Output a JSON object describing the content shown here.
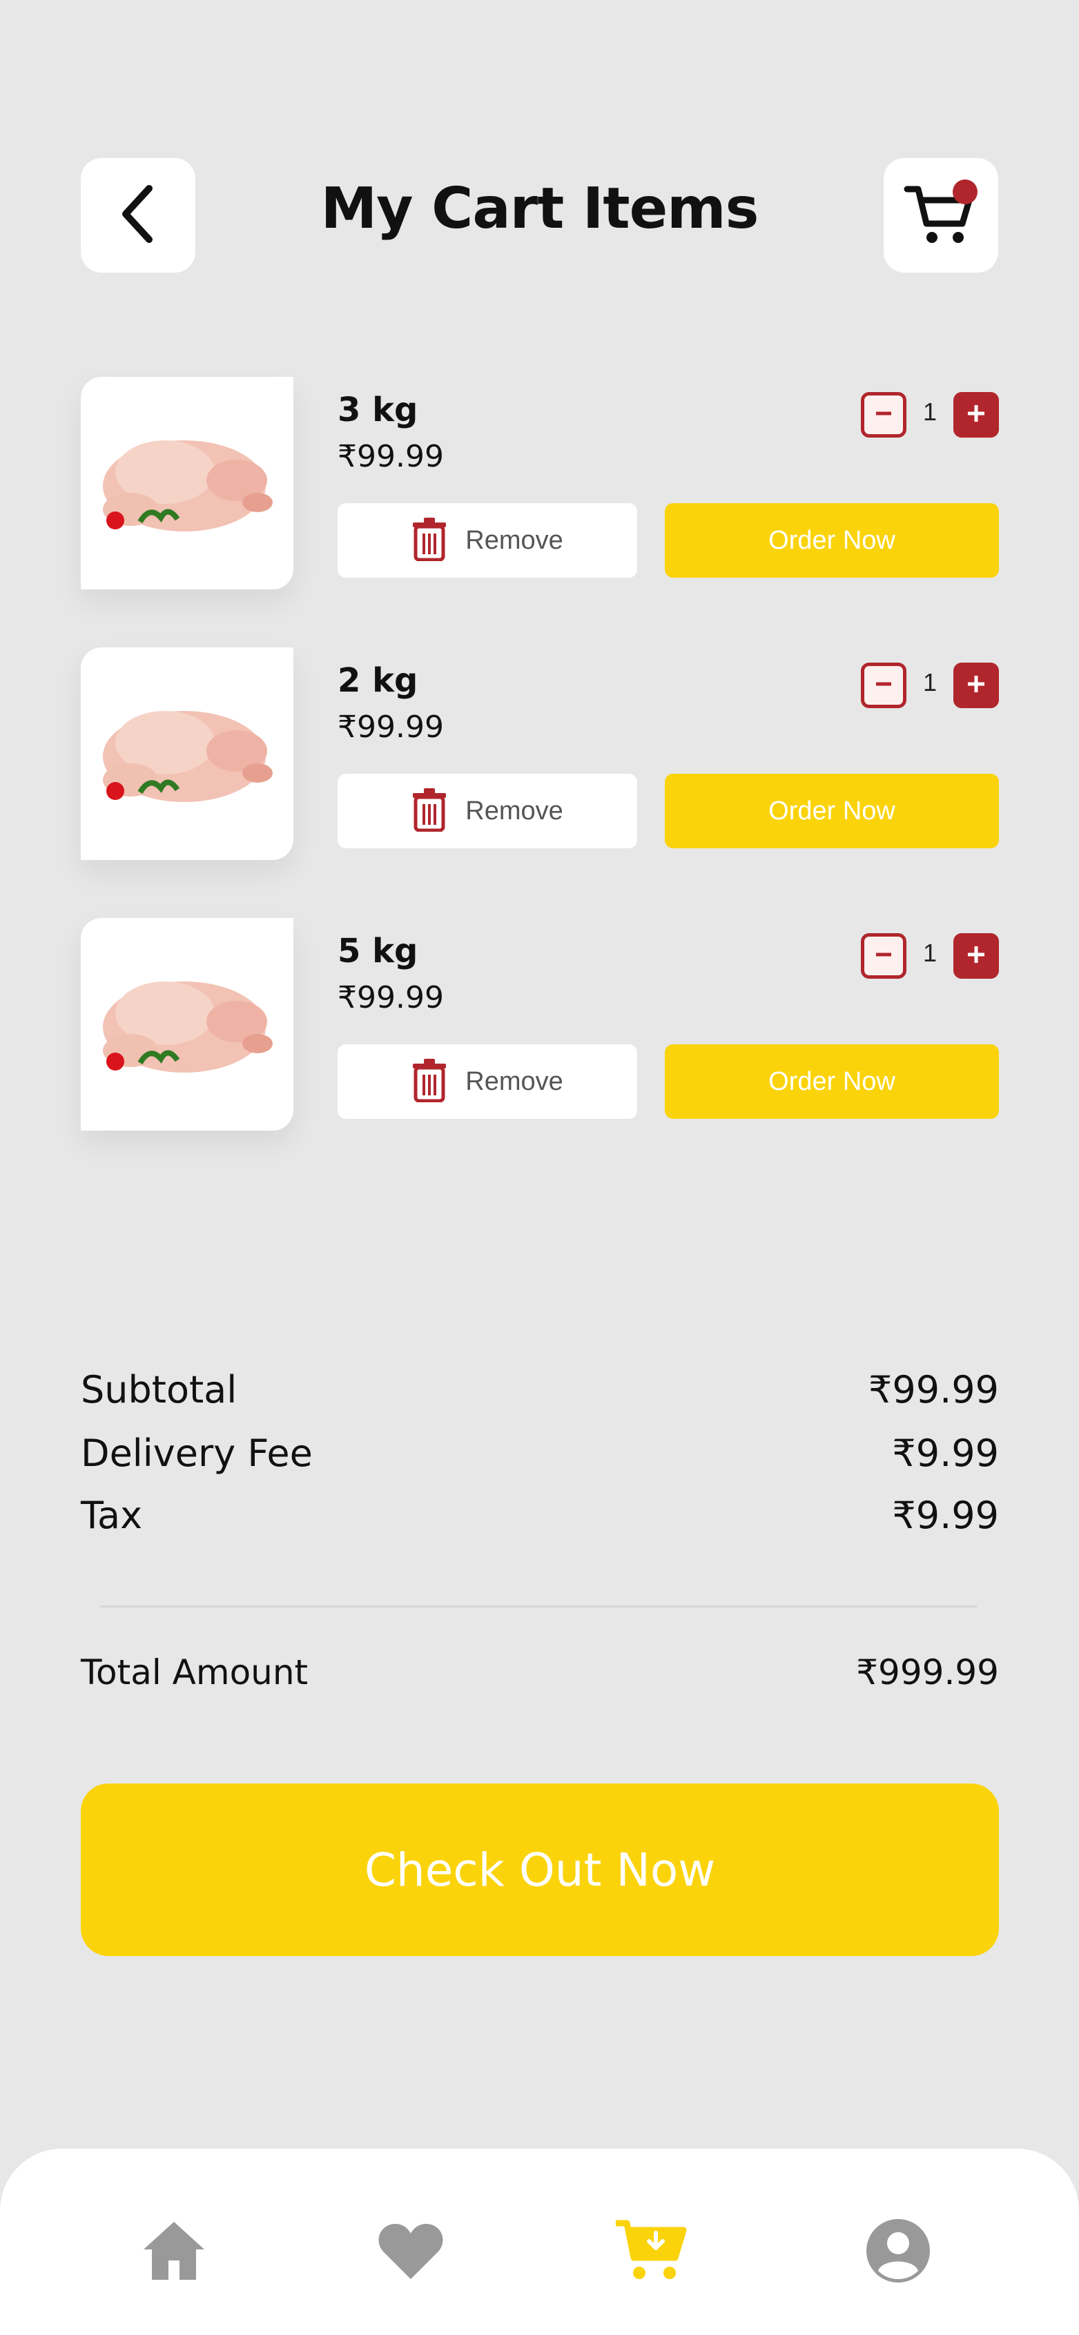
{
  "header": {
    "title": "My Cart Items",
    "back_icon": "chevron-left-icon",
    "cart_icon": "cart-icon"
  },
  "items": [
    {
      "weight": "3 kg",
      "price": "₹99.99",
      "quantity": "1",
      "remove_label": "Remove",
      "order_label": "Order Now"
    },
    {
      "weight": "2 kg",
      "price": "₹99.99",
      "quantity": "1",
      "remove_label": "Remove",
      "order_label": "Order Now"
    },
    {
      "weight": "5 kg",
      "price": "₹99.99",
      "quantity": "1",
      "remove_label": "Remove",
      "order_label": "Order Now"
    }
  ],
  "summary": {
    "subtotal_label": "Subtotal",
    "subtotal_value": "₹99.99",
    "delivery_label": "Delivery Fee",
    "delivery_value": "₹9.99",
    "tax_label": "Tax",
    "tax_value": "₹9.99",
    "total_label": "Total Amount",
    "total_value": "₹999.99"
  },
  "checkout": {
    "label": "Check Out Now"
  },
  "bottom_nav": {
    "items": [
      {
        "icon": "home-icon",
        "active": false
      },
      {
        "icon": "heart-icon",
        "active": false
      },
      {
        "icon": "cart-download-icon",
        "active": true
      },
      {
        "icon": "user-icon",
        "active": false
      }
    ]
  },
  "colors": {
    "accent": "#fbd30b",
    "danger": "#b0262c",
    "background": "#e7e7e7",
    "nav_inactive": "#999999"
  }
}
